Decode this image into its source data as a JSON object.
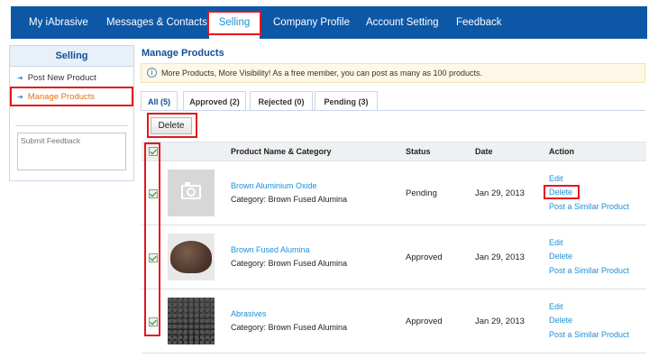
{
  "nav": {
    "tabs": [
      {
        "label": "My iAbrasive"
      },
      {
        "label": "Messages & Contacts"
      },
      {
        "label": "Selling"
      },
      {
        "label": "Company Profile"
      },
      {
        "label": "Account Setting"
      },
      {
        "label": "Feedback"
      }
    ],
    "active": "Selling"
  },
  "sidebar": {
    "title": "Selling",
    "items": [
      {
        "label": "Post New Product"
      },
      {
        "label": "Manage Products"
      }
    ],
    "feedback_placeholder": "Submit Feedback"
  },
  "main": {
    "title": "Manage Products",
    "notice": "More Products, More Visibility! As a free member, you can post as many as 100 products.",
    "tabs": [
      {
        "label": "All (5)"
      },
      {
        "label": "Approved (2)"
      },
      {
        "label": "Rejected (0)"
      },
      {
        "label": "Pending (3)"
      }
    ],
    "delete_label": "Delete",
    "columns": {
      "name": "Product Name & Category",
      "status": "Status",
      "date": "Date",
      "action": "Action"
    },
    "rows": [
      {
        "name": "Brown Aluminium Oxide",
        "category": "Category: Brown Fused Alumina",
        "status": "Pending",
        "date": "Jan 29, 2013",
        "edit": "Edit",
        "delete": "Delete",
        "similar": "Post a Similar Product",
        "image": "camera-placeholder-icon"
      },
      {
        "name": "Brown Fused Alumina",
        "category": "Category: Brown Fused Alumina",
        "status": "Approved",
        "date": "Jan 29, 2013",
        "edit": "Edit",
        "delete": "Delete",
        "similar": "Post a Similar Product",
        "image": "brown-sand-photo"
      },
      {
        "name": "Abrasives",
        "category": "Category: Brown Fused Alumina",
        "status": "Approved",
        "date": "Jan 29, 2013",
        "edit": "Edit",
        "delete": "Delete",
        "similar": "Post a Similar Product",
        "image": "black-grit-photo"
      }
    ]
  },
  "colors": {
    "nav_background": "#0d57a7",
    "link": "#1e90d6",
    "active_sidebar": "#e27512",
    "highlight": "#e3161d"
  }
}
